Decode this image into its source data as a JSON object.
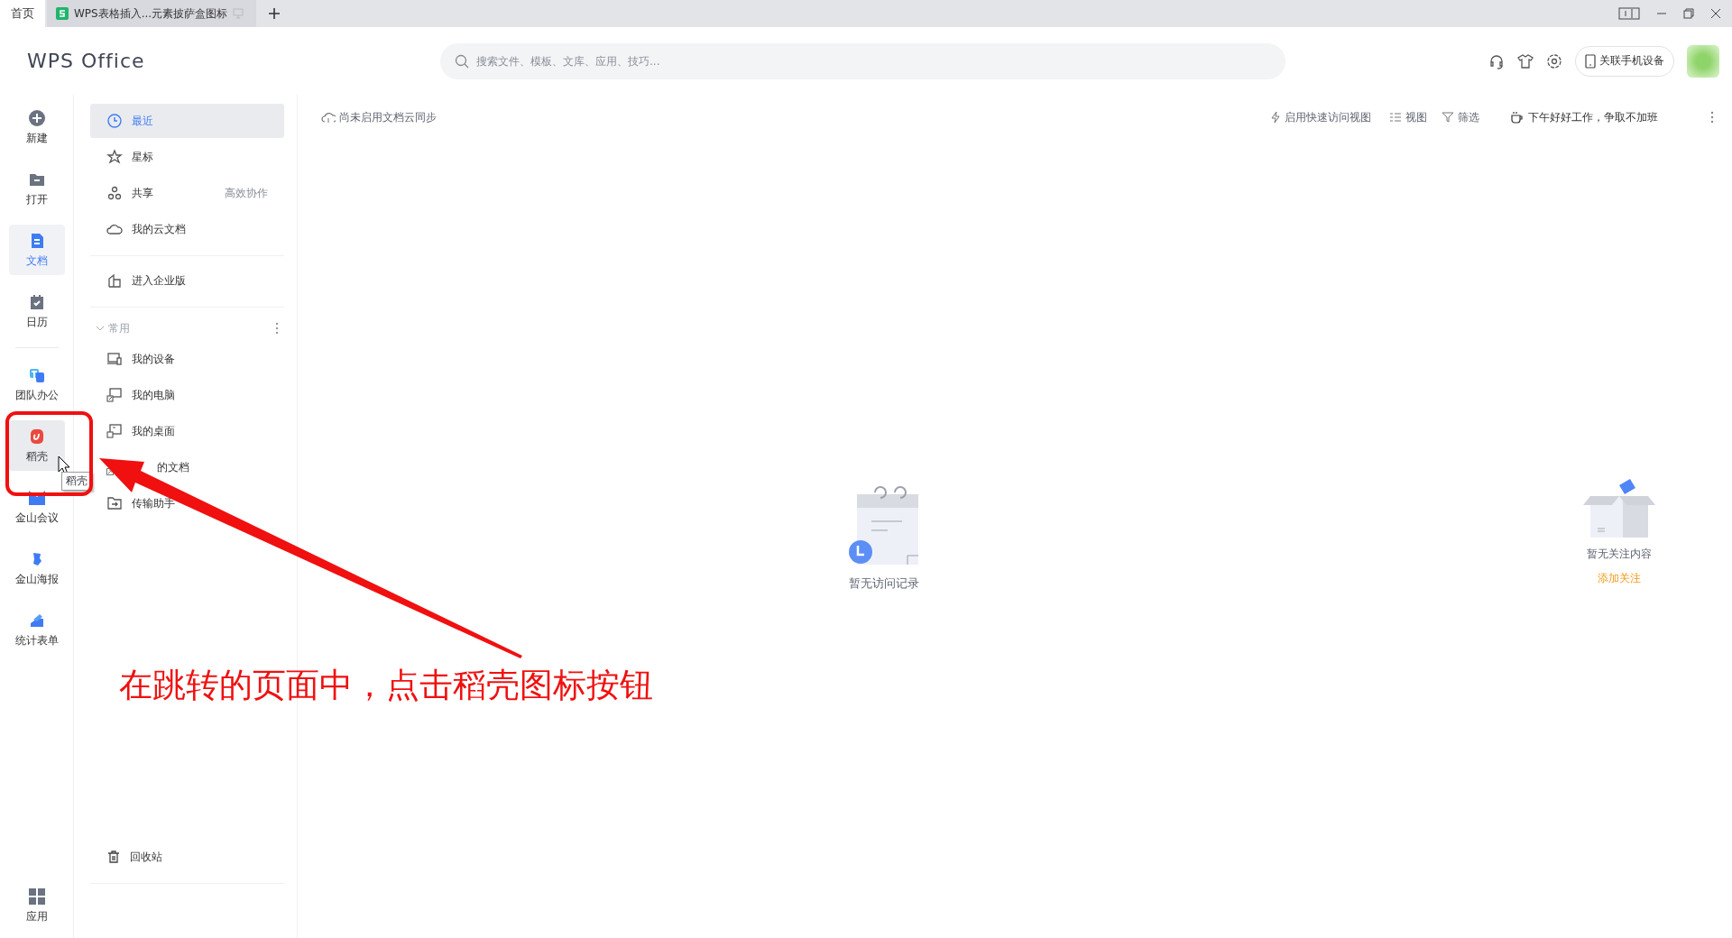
{
  "tabs": [
    {
      "label": "首页",
      "selected": true
    },
    {
      "label": "WPS表格插入...元素披萨盒图标",
      "selected": false
    }
  ],
  "header": {
    "logo": "WPS Office",
    "search": {
      "placeholder": "搜索文件、模板、文库、应用、技巧..."
    },
    "phone_button": "关联手机设备"
  },
  "rail": {
    "main": [
      {
        "label": "新建",
        "selected": false,
        "hovered": false
      },
      {
        "label": "打开",
        "selected": false,
        "hovered": false
      },
      {
        "label": "文档",
        "selected": true,
        "hovered": false
      },
      {
        "label": "日历",
        "selected": false,
        "hovered": false
      }
    ],
    "apps": [
      {
        "label": "团队办公",
        "selected": false,
        "hovered": false
      },
      {
        "label": "稻壳",
        "selected": false,
        "hovered": true
      },
      {
        "label": "金山会议",
        "selected": false,
        "hovered": false
      },
      {
        "label": "金山海报",
        "selected": false,
        "hovered": false
      },
      {
        "label": "统计表单",
        "selected": false,
        "hovered": false
      }
    ],
    "bottom": {
      "label": "应用"
    }
  },
  "tooltip": "稻壳",
  "nav": {
    "items": [
      {
        "label": "最近",
        "selected": true
      },
      {
        "label": "星标",
        "selected": false
      },
      {
        "label": "共享",
        "selected": false,
        "note": "高效协作"
      },
      {
        "label": "我的云文档",
        "selected": false
      }
    ],
    "enterprise": "进入企业版",
    "section": {
      "title": "常用",
      "expanded": true,
      "items": [
        {
          "label": "我的设备"
        },
        {
          "label": "我的电脑"
        },
        {
          "label": "我的桌面"
        },
        {
          "label": "的文档"
        },
        {
          "label": "传输助手"
        }
      ]
    },
    "recycle": "回收站"
  },
  "toolbar": {
    "sync": "尚未启用文档云同步",
    "quick_view": "启用快速访问视图",
    "view": "视图",
    "filter": "筛选",
    "greeting": "下午好好工作，争取不加班"
  },
  "empty": {
    "text": "暂无访问记录"
  },
  "follow": {
    "text": "暂无关注内容",
    "link": "添加关注"
  },
  "annotation": {
    "caption": "在跳转的页面中，点击稻壳图标按钮"
  }
}
